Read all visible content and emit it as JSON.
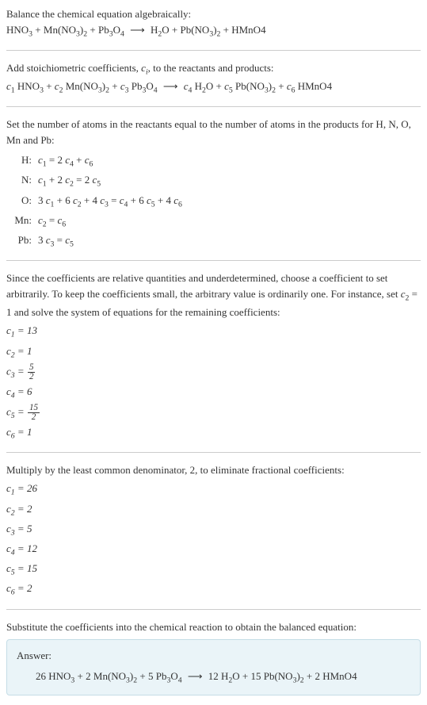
{
  "intro": {
    "line1": "Balance the chemical equation algebraically:",
    "eq_lhs": "HNO₃ + Mn(NO₃)₂ + Pb₃O₄",
    "eq_rhs": "H₂O + Pb(NO₃)₂ + HMnO4"
  },
  "stoich": {
    "line1_a": "Add stoichiometric coefficients, ",
    "line1_var": "cᵢ",
    "line1_b": ", to the reactants and products:",
    "eq_lhs": "c₁ HNO₃ + c₂ Mn(NO₃)₂ + c₃ Pb₃O₄",
    "eq_rhs": "c₄ H₂O + c₅ Pb(NO₃)₂ + c₆ HMnO4"
  },
  "atoms": {
    "intro": "Set the number of atoms in the reactants equal to the number of atoms in the products for H, N, O, Mn and Pb:",
    "rows": [
      {
        "label": "H:",
        "eq": "c₁ = 2 c₄ + c₆"
      },
      {
        "label": "N:",
        "eq": "c₁ + 2 c₂ = 2 c₅"
      },
      {
        "label": "O:",
        "eq": "3 c₁ + 6 c₂ + 4 c₃ = c₄ + 6 c₅ + 4 c₆"
      },
      {
        "label": "Mn:",
        "eq": "c₂ = c₆"
      },
      {
        "label": "Pb:",
        "eq": "3 c₃ = c₅"
      }
    ]
  },
  "solve1": {
    "intro": "Since the coefficients are relative quantities and underdetermined, choose a coefficient to set arbitrarily. To keep the coefficients small, the arbitrary value is ordinarily one. For instance, set c₂ = 1 and solve the system of equations for the remaining coefficients:",
    "coefs": [
      {
        "lhs": "c₁",
        "rhs": "13",
        "frac": false
      },
      {
        "lhs": "c₂",
        "rhs": "1",
        "frac": false
      },
      {
        "lhs": "c₃",
        "num": "5",
        "den": "2",
        "frac": true
      },
      {
        "lhs": "c₄",
        "rhs": "6",
        "frac": false
      },
      {
        "lhs": "c₅",
        "num": "15",
        "den": "2",
        "frac": true
      },
      {
        "lhs": "c₆",
        "rhs": "1",
        "frac": false
      }
    ]
  },
  "solve2": {
    "intro": "Multiply by the least common denominator, 2, to eliminate fractional coefficients:",
    "coefs": [
      {
        "lhs": "c₁",
        "rhs": "26"
      },
      {
        "lhs": "c₂",
        "rhs": "2"
      },
      {
        "lhs": "c₃",
        "rhs": "5"
      },
      {
        "lhs": "c₄",
        "rhs": "12"
      },
      {
        "lhs": "c₅",
        "rhs": "15"
      },
      {
        "lhs": "c₆",
        "rhs": "2"
      }
    ]
  },
  "final": {
    "intro": "Substitute the coefficients into the chemical reaction to obtain the balanced equation:",
    "answer_label": "Answer:",
    "eq_lhs": "26 HNO₃ + 2 Mn(NO₃)₂ + 5 Pb₃O₄",
    "eq_rhs": "12 H₂O + 15 Pb(NO₃)₂ + 2 HMnO4"
  },
  "arrow": "⟶"
}
